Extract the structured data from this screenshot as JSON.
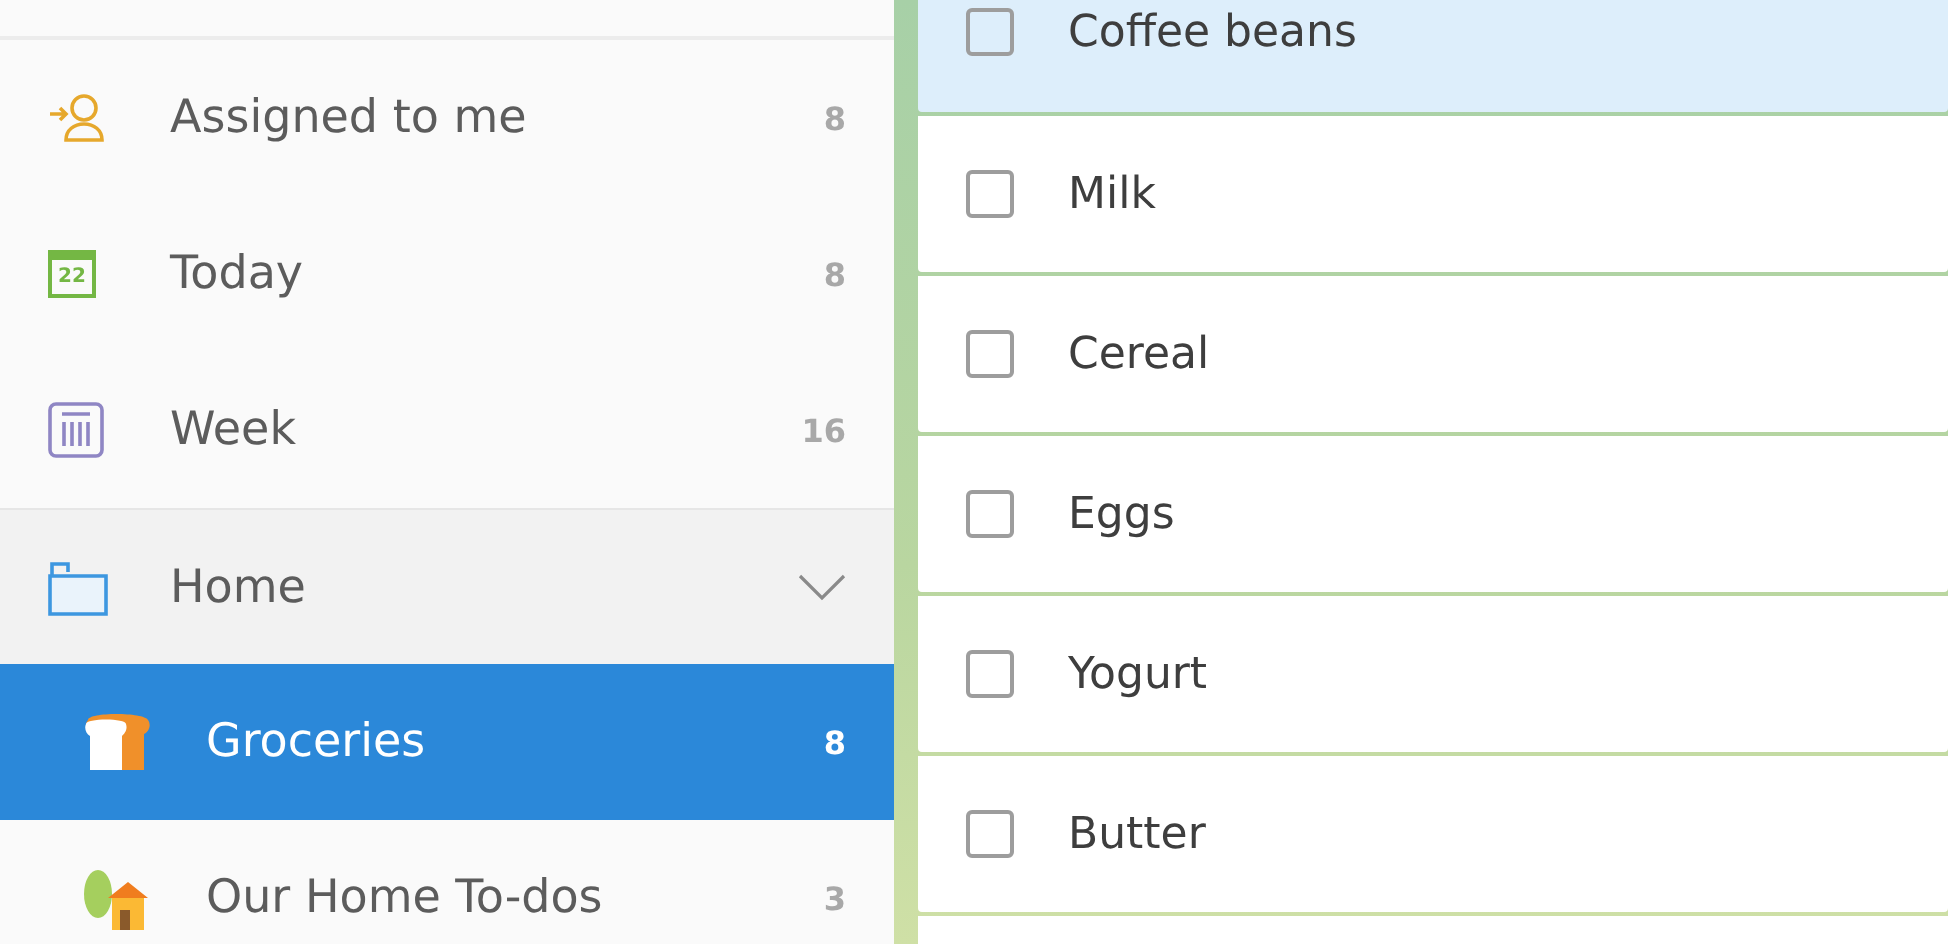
{
  "sidebar": {
    "items": [
      {
        "kind": "assigned",
        "label": "Assigned to me",
        "count": "8",
        "selected": false
      },
      {
        "kind": "today",
        "label": "Today",
        "count": "8",
        "icon_text": "22",
        "selected": false
      },
      {
        "kind": "week",
        "label": "Week",
        "count": "16",
        "selected": false
      },
      {
        "kind": "folder",
        "label": "Home",
        "expanded": true,
        "children": [
          {
            "kind": "bread",
            "label": "Groceries",
            "count": "8",
            "selected": true
          },
          {
            "kind": "house",
            "label": "Our Home To-dos",
            "count": "3",
            "selected": false
          }
        ]
      }
    ]
  },
  "tasks": [
    {
      "title": "Coffee beans",
      "checked": false,
      "selected": true
    },
    {
      "title": "Milk",
      "checked": false,
      "selected": false
    },
    {
      "title": "Cereal",
      "checked": false,
      "selected": false
    },
    {
      "title": "Eggs",
      "checked": false,
      "selected": false
    },
    {
      "title": "Yogurt",
      "checked": false,
      "selected": false
    },
    {
      "title": "Butter",
      "checked": false,
      "selected": false
    }
  ]
}
